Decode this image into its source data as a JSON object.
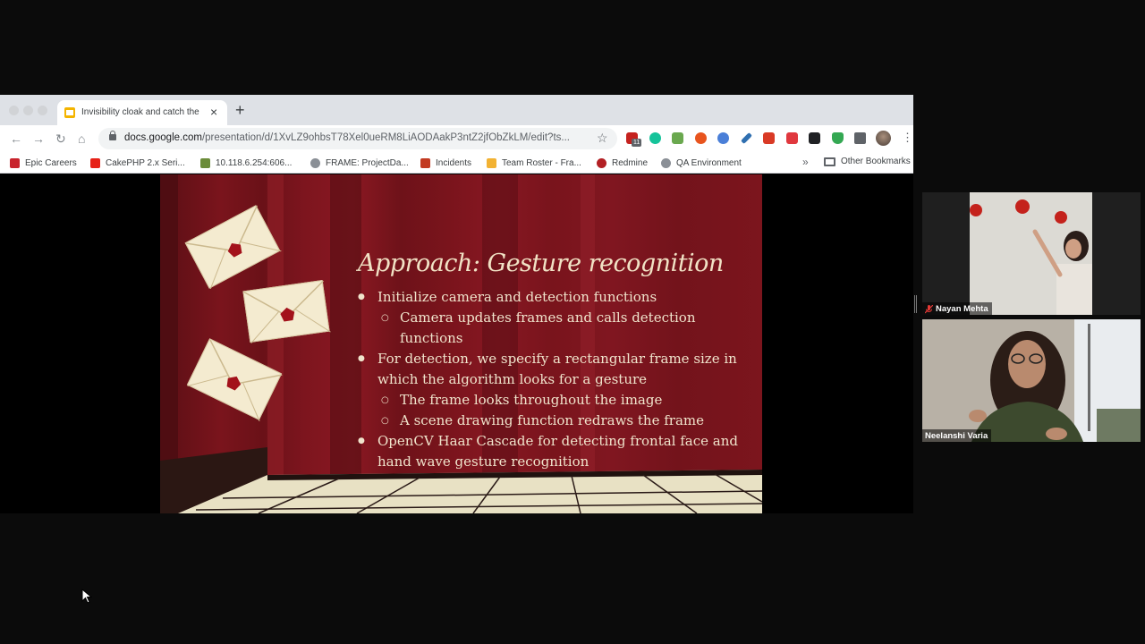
{
  "browser": {
    "tab_title": "Invisibility cloak and catch the",
    "tab_close": "×",
    "new_tab": "+",
    "nav": {
      "back": "←",
      "forward": "→",
      "reload": "↻",
      "home": "⌂"
    },
    "url_host": "docs.google.com",
    "url_path": "/presentation/d/1XvLZ9ohbsT78Xel0ueRM8LiAODAakP3ntZ2jfObZkLM/edit?ts...",
    "extension_badge": "11",
    "menu": "⋮",
    "bookmarks": [
      {
        "label": "Epic Careers",
        "color": "#c8232c"
      },
      {
        "label": "CakePHP 2.x Seri...",
        "color": "#e62117"
      },
      {
        "label": "10.118.6.254:606...",
        "color": "#6b8c3a"
      },
      {
        "label": "FRAME: ProjectDa...",
        "color": "#8a8f96"
      },
      {
        "label": "Incidents",
        "color": "#c23b22"
      },
      {
        "label": "Team Roster - Fra...",
        "color": "#f2b233"
      },
      {
        "label": "Redmine",
        "color": "#b32024"
      },
      {
        "label": "QA Environment",
        "color": "#8a8f96"
      }
    ],
    "bookmarks_more": "»",
    "other_bookmarks": "Other Bookmarks"
  },
  "slide": {
    "title": "Approach: Gesture recognition",
    "bullets": [
      {
        "level": 1,
        "text": "Initialize camera and detection functions"
      },
      {
        "level": 2,
        "text": "Camera updates frames and calls detection functions"
      },
      {
        "level": 1,
        "text": "For detection, we specify a rectangular frame size in which the algorithm looks for a gesture"
      },
      {
        "level": 2,
        "text": "The frame looks throughout the image"
      },
      {
        "level": 2,
        "text": "A scene drawing function redraws the frame"
      },
      {
        "level": 1,
        "text": "OpenCV Haar Cascade for detecting frontal face and hand wave gesture recognition"
      }
    ]
  },
  "participants": [
    {
      "name": "Nayan Mehta",
      "muted": true
    },
    {
      "name": "Neelanshi Varia",
      "muted": false
    }
  ]
}
